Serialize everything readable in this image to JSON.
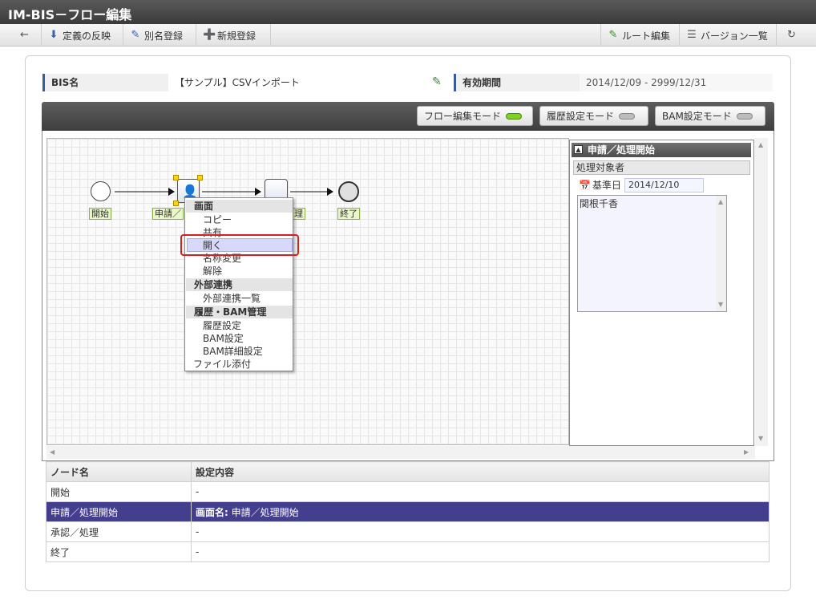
{
  "window": {
    "title": "IM-BIS－フロー編集"
  },
  "toolbar": {
    "back_icon": "back-arrow-icon",
    "apply_label": "定義の反映",
    "alias_label": "別名登録",
    "new_label": "新規登録",
    "route_label": "ルート編集",
    "versions_label": "バージョン一覧",
    "refresh_icon": "refresh-icon"
  },
  "info": {
    "bis_name_label": "BIS名",
    "bis_name_value": "【サンプル】CSVインポート",
    "period_label": "有効期間",
    "period_value": "2014/12/09 - 2999/12/31"
  },
  "modes": {
    "flow_edit": "フロー編集モード",
    "history": "履歴設定モード",
    "bam": "BAM設定モード",
    "active": "flow_edit"
  },
  "flow": {
    "nodes": [
      {
        "label": "開始"
      },
      {
        "label": "申請／"
      },
      {
        "label": "理"
      },
      {
        "label": "終了"
      }
    ]
  },
  "context_menu": {
    "sections": [
      {
        "title": "画面",
        "items": [
          "コピー",
          "共有",
          "開く",
          "名称変更",
          "解除"
        ]
      },
      {
        "title": "外部連携",
        "items": [
          "外部連携一覧"
        ]
      },
      {
        "title": "履歴・BAM管理",
        "items": [
          "履歴設定",
          "BAM設定",
          "BAM詳細設定"
        ]
      }
    ],
    "footer": "ファイル添付",
    "selected": "開く"
  },
  "property_panel": {
    "title": "申請／処理開始",
    "subtitle": "処理対象者",
    "date_label": "基準日",
    "date_value": "2014/12/10",
    "list_items": [
      "関根千香"
    ]
  },
  "table": {
    "headers": [
      "ノード名",
      "設定内容"
    ],
    "rows": [
      {
        "node": "開始",
        "setting_label": "",
        "setting": "-"
      },
      {
        "node": "申請／処理開始",
        "setting_label": "画面名:",
        "setting": "申請／処理開始"
      },
      {
        "node": "承認／処理",
        "setting_label": "",
        "setting": "-"
      },
      {
        "node": "終了",
        "setting_label": "",
        "setting": "-"
      }
    ],
    "selected_row": 1
  }
}
